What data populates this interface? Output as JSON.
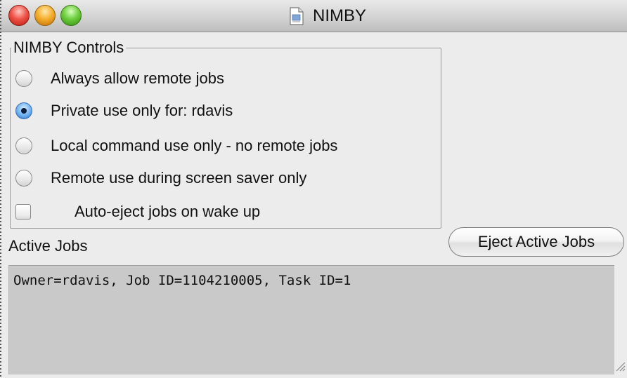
{
  "window": {
    "title": "NIMBY"
  },
  "controls": {
    "group_label": "NIMBY Controls",
    "options": [
      {
        "label": "Always allow remote jobs",
        "selected": false
      },
      {
        "label": "Private use only for: rdavis",
        "selected": true
      },
      {
        "label": "Local command use only - no remote jobs",
        "selected": false
      },
      {
        "label": "Remote use during screen saver only",
        "selected": false
      }
    ],
    "auto_eject": {
      "label": "Auto-eject jobs on wake up",
      "checked": false
    }
  },
  "jobs": {
    "label": "Active Jobs",
    "eject_button_label": "Eject Active Jobs",
    "entries": [
      "Owner=rdavis, Job ID=1104210005, Task ID=1"
    ]
  },
  "icons": {
    "close": "close-icon",
    "minimize": "minimize-icon",
    "zoom": "zoom-icon",
    "document": "document-icon",
    "resize": "resize-grip-icon"
  }
}
